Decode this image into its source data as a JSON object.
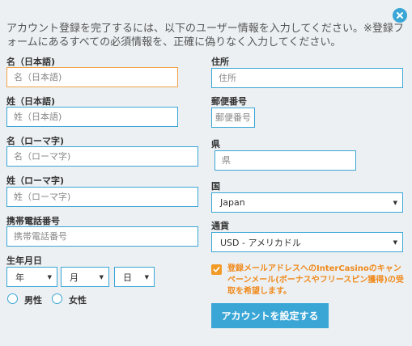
{
  "intro_text": "アカウント登録を完了するには、以下のユーザー情報を入力してください。※登録フォームにあるすべての必須情報を、正確に偽りなく入力してください。",
  "fields": {
    "first_name_jp": {
      "label": "名（日本語)",
      "placeholder": "名（日本語)"
    },
    "last_name_jp": {
      "label": "姓（日本語)",
      "placeholder": "姓（日本語)"
    },
    "first_name_romaji": {
      "label": "名（ローマ字)",
      "placeholder": "名（ローマ字)"
    },
    "last_name_romaji": {
      "label": "姓（ローマ字)",
      "placeholder": "姓（ローマ字)"
    },
    "mobile": {
      "label": "携帯電話番号",
      "placeholder": "携帯電話番号"
    },
    "address": {
      "label": "住所",
      "placeholder": "住所"
    },
    "postal_code": {
      "label": "郵便番号",
      "placeholder": "郵便番号"
    },
    "prefecture": {
      "label": "県",
      "placeholder": "県"
    }
  },
  "birthdate": {
    "label": "生年月日",
    "year": "年",
    "month": "月",
    "day": "日"
  },
  "gender": {
    "male": "男性",
    "female": "女性"
  },
  "country": {
    "label": "国",
    "value": "Japan"
  },
  "currency": {
    "label": "通貨",
    "value": "USD - アメリカドル"
  },
  "optin_text": "登録メールアドレスへのInterCasinoのキャンペーンメール(ボーナスやフリースピン獲得)の受取を希望します。",
  "submit_label": "アカウントを設定する",
  "colors": {
    "accent": "#3aa6d6",
    "orange": "#f19a26",
    "background": "#ecf0f3"
  }
}
